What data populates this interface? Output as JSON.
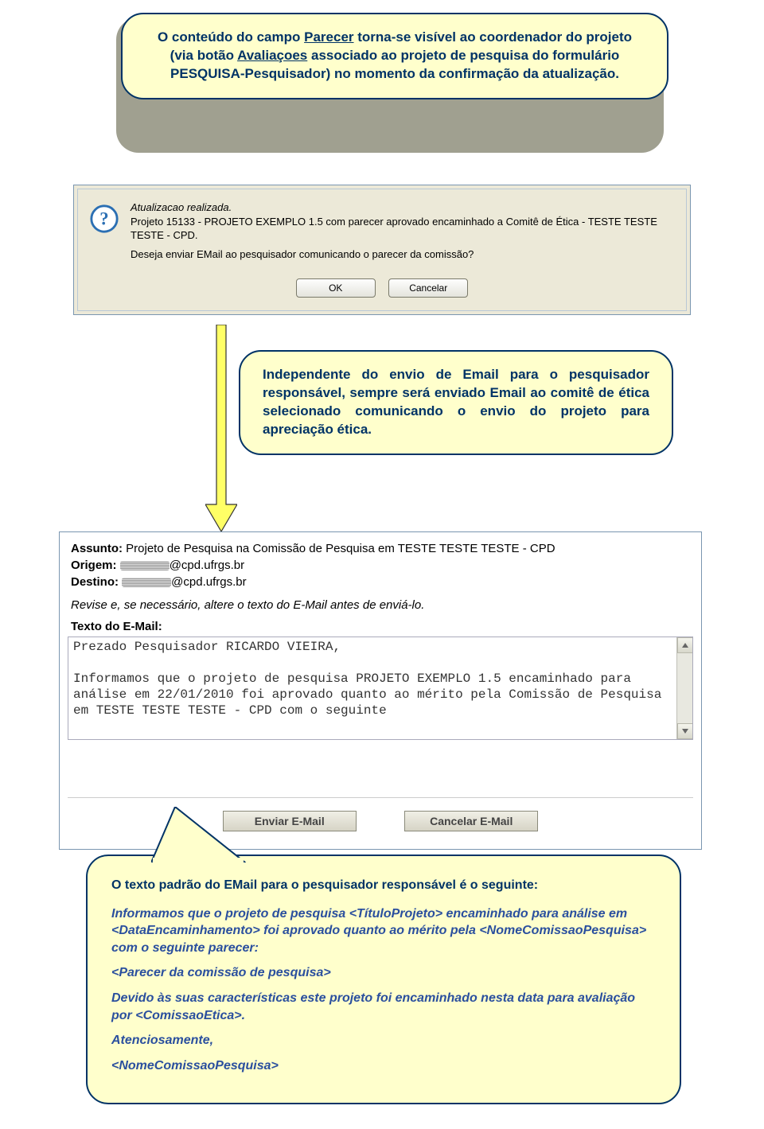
{
  "callout1": {
    "text_pre": "O conteúdo do campo ",
    "u1": "Parecer",
    "text_mid1": " torna-se visível ao coordenador do projeto (via botão ",
    "u2": "Avaliaçoes",
    "text_mid2": " associado ao projeto de pesquisa do formulário PESQUISA-Pesquisador) no momento da confirmação da atualização."
  },
  "dialog1": {
    "line1": "Atualizacao realizada.",
    "line2": "Projeto 15133 - PROJETO EXEMPLO 1.5 com parecer aprovado encaminhado a Comitê de Ética - TESTE TESTE TESTE - CPD.",
    "line3": "Deseja enviar EMail ao pesquisador comunicando o parecer da comissão?",
    "ok": "OK",
    "cancel": "Cancelar"
  },
  "callout2": {
    "text": "Independente do envio de Email para o pesquisador responsável, sempre será enviado Email ao comitê de ética selecionado comunicando o envio do projeto para apreciação ética."
  },
  "email": {
    "assunto_label": "Assunto:",
    "assunto_value": " Projeto de Pesquisa na Comissão de Pesquisa em TESTE TESTE TESTE - CPD",
    "origem_label": "Origem:",
    "origem_value": "@cpd.ufrgs.br",
    "destino_label": "Destino:",
    "destino_value": "@cpd.ufrgs.br",
    "instrucao": "Revise e, se necessário, altere o texto do E-Mail antes de enviá-lo.",
    "texto_label": "Texto do E-Mail:",
    "body": "Prezado Pesquisador RICARDO VIEIRA,\n\nInformamos que o projeto de pesquisa PROJETO EXEMPLO 1.5 encaminhado para análise em 22/01/2010 foi aprovado quanto ao mérito pela Comissão de Pesquisa em TESTE TESTE TESTE - CPD com o seguinte",
    "btn_send": "Enviar E-Mail",
    "btn_cancel": "Cancelar E-Mail"
  },
  "callout3": {
    "heading": "O texto padrão do EMail para o pesquisador responsável é o seguinte:",
    "p1": "Informamos que o projeto de pesquisa <TítuloProjeto> encaminhado para análise em <DataEncaminhamento> foi aprovado quanto ao mérito pela <NomeComissaoPesquisa> com o seguinte parecer:",
    "p2": "<Parecer da comissão de pesquisa>",
    "p3": "Devido às suas características este projeto foi encaminhado nesta data para avaliação por <ComissaoEtica>.",
    "p4": "Atenciosamente,",
    "p5": "<NomeComissaoPesquisa>"
  }
}
